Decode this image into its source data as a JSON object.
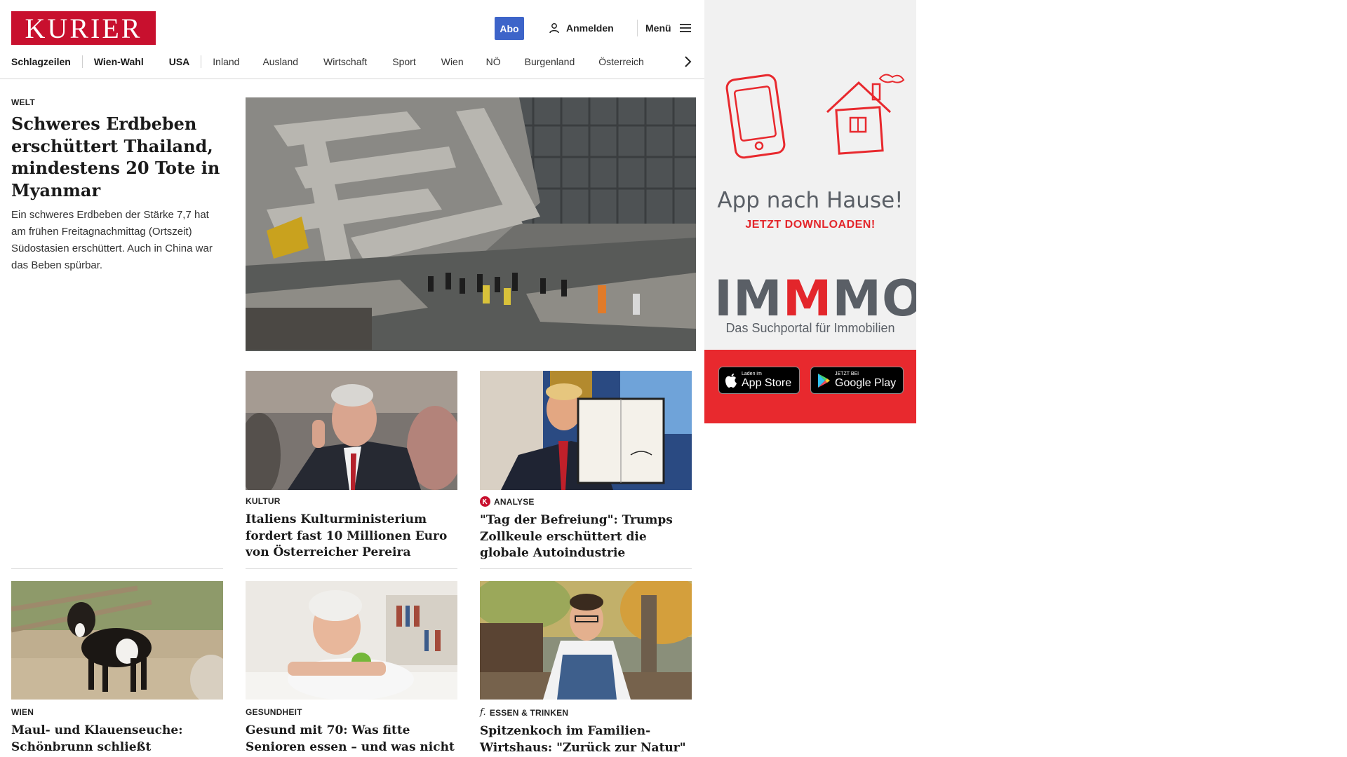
{
  "header": {
    "logo": "KURIER",
    "abo_label": "Abo",
    "login_label": "Anmelden",
    "menu_label": "Menü",
    "brand_color": "#c8102e"
  },
  "nav": {
    "items": [
      "Schlagzeilen",
      "Wien-Wahl",
      "USA",
      "Inland",
      "Ausland",
      "Wirtschaft",
      "Sport",
      "Wien",
      "NÖ",
      "Burgenland",
      "Österreich"
    ]
  },
  "lead": {
    "category": "WELT",
    "headline": "Schweres Erdbeben erschüttert Thailand, mindestens 20 Tote in Myanmar",
    "teaser": "Ein schweres Erdbeben der Stärke 7,7 hat am frühen Freitagnachmittag (Ortszeit) Südostasien erschüttert. Auch in China war das Beben spürbar."
  },
  "articles": [
    {
      "category": "KULTUR",
      "headline": "Italiens Kulturministerium fordert fast 10 Millionen Euro von Österreicher Pereira"
    },
    {
      "category": "ANALYSE",
      "headline": "\"Tag der Befreiung\": Trumps Zollkeule erschüttert die globale Autoindustrie"
    },
    {
      "category": "WIEN",
      "headline": "Maul- und Klauenseuche: Schönbrunn schließt vorsichtshalber Streichelzoo"
    },
    {
      "category": "GESUNDHEIT",
      "headline": "Gesund mit 70: Was fitte Senioren essen – und was nicht"
    },
    {
      "category": "ESSEN & TRINKEN",
      "headline": "Spitzenkoch im Familien-Wirtshaus: \"Zurück zur Natur\" auf Top-Niveau"
    }
  ],
  "ad": {
    "title": "App nach Hause!",
    "subtitle": "JETZT DOWNLOADEN!",
    "brand": [
      "IM",
      "M",
      "MO"
    ],
    "tagline": "Das Suchportal für Immobilien",
    "appstore_small": "Laden im",
    "appstore_big": "App Store",
    "googleplay_small": "JETZT BEI",
    "googleplay_big": "Google Play",
    "accent_color": "#e8292e"
  }
}
